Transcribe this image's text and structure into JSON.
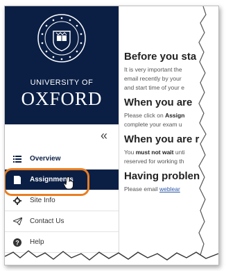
{
  "logo": {
    "line1": "UNIVERSITY OF",
    "line2": "OXFORD"
  },
  "sidebar": {
    "collapse_glyph": "«",
    "items": [
      {
        "label": "Overview",
        "icon": "list-icon"
      },
      {
        "label": "Assignments",
        "icon": "document-icon"
      },
      {
        "label": "Site Info",
        "icon": "gear-icon"
      },
      {
        "label": "Contact Us",
        "icon": "send-icon"
      },
      {
        "label": "Help",
        "icon": "question-icon"
      }
    ]
  },
  "content": {
    "sections": [
      {
        "heading": "Before you sta",
        "lines": [
          "It is very important the",
          "email recently by your",
          "and start time of your e"
        ]
      },
      {
        "heading": "When you are",
        "lines_rich": [
          [
            "Please click on ",
            "Assign"
          ],
          [
            "complete your exam u",
            ""
          ]
        ]
      },
      {
        "heading": "When you are r",
        "lines_rich": [
          [
            "You ",
            "must not wait",
            " unti"
          ],
          [
            "reserved for working th",
            "",
            ""
          ]
        ]
      },
      {
        "heading": "Having problen",
        "link_prefix": "Please email ",
        "link_text": "weblear"
      }
    ]
  },
  "colors": {
    "navy": "#0b1f45",
    "highlight": "#ea7d20",
    "link": "#2a57a6"
  }
}
